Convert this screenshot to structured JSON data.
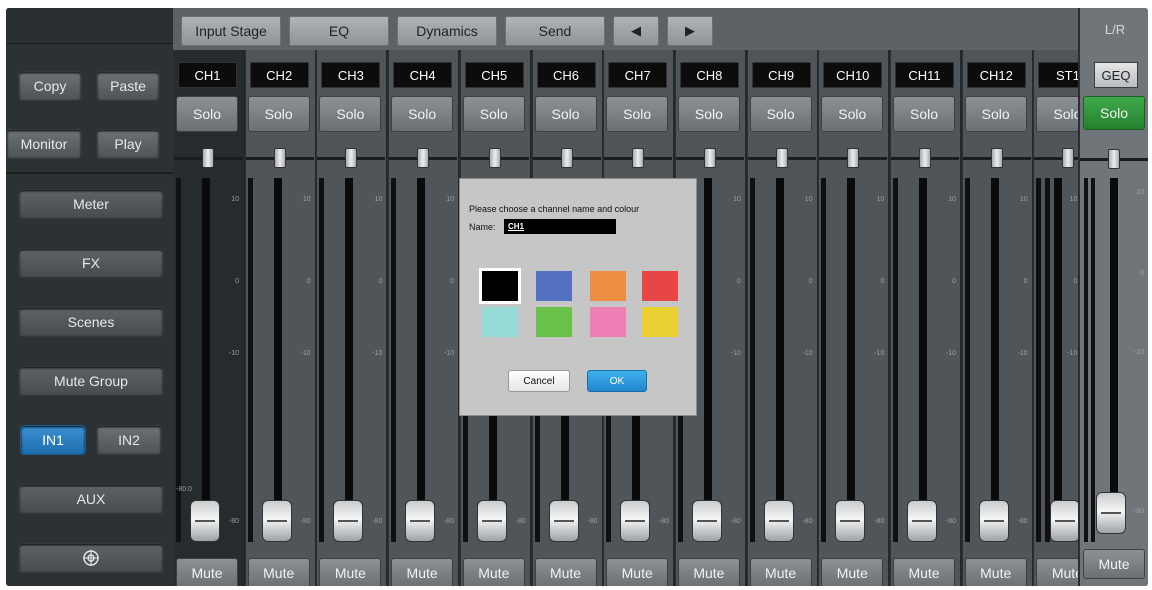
{
  "left_panel": {
    "copy": "Copy",
    "paste": "Paste",
    "monitor": "Monitor",
    "play": "Play",
    "meter": "Meter",
    "fx": "FX",
    "scenes": "Scenes",
    "mute_group": "Mute Group",
    "in1": "IN1",
    "in2": "IN2",
    "aux": "AUX",
    "settings_icon": "target-icon"
  },
  "tabs": {
    "input_stage": "Input Stage",
    "eq": "EQ",
    "dynamics": "Dynamics",
    "send": "Send",
    "prev": "◀",
    "next": "▶"
  },
  "channels": [
    "CH1",
    "CH2",
    "CH3",
    "CH4",
    "CH5",
    "CH6",
    "CH7",
    "CH8",
    "CH9",
    "CH10",
    "CH11",
    "CH12",
    "ST1"
  ],
  "solo_label": "Solo",
  "mute_label": "Mute",
  "scale": {
    "top": "10",
    "zero": "0",
    "minus10": "-10",
    "bottom": "-80"
  },
  "ch1_level_readout": "-80.0",
  "master": {
    "title": "L/R",
    "geq": "GEQ",
    "solo": "Solo",
    "mute": "Mute"
  },
  "dialog": {
    "prompt": "Please choose a channel name and colour",
    "name_label": "Name:",
    "name_value": "CH1",
    "colors": [
      "#000000",
      "#5470c0",
      "#ee8e45",
      "#e64646",
      "#98dad6",
      "#69c14a",
      "#ef7eb4",
      "#e9d131"
    ],
    "selected_color": "#000000",
    "cancel": "Cancel",
    "ok": "OK"
  }
}
